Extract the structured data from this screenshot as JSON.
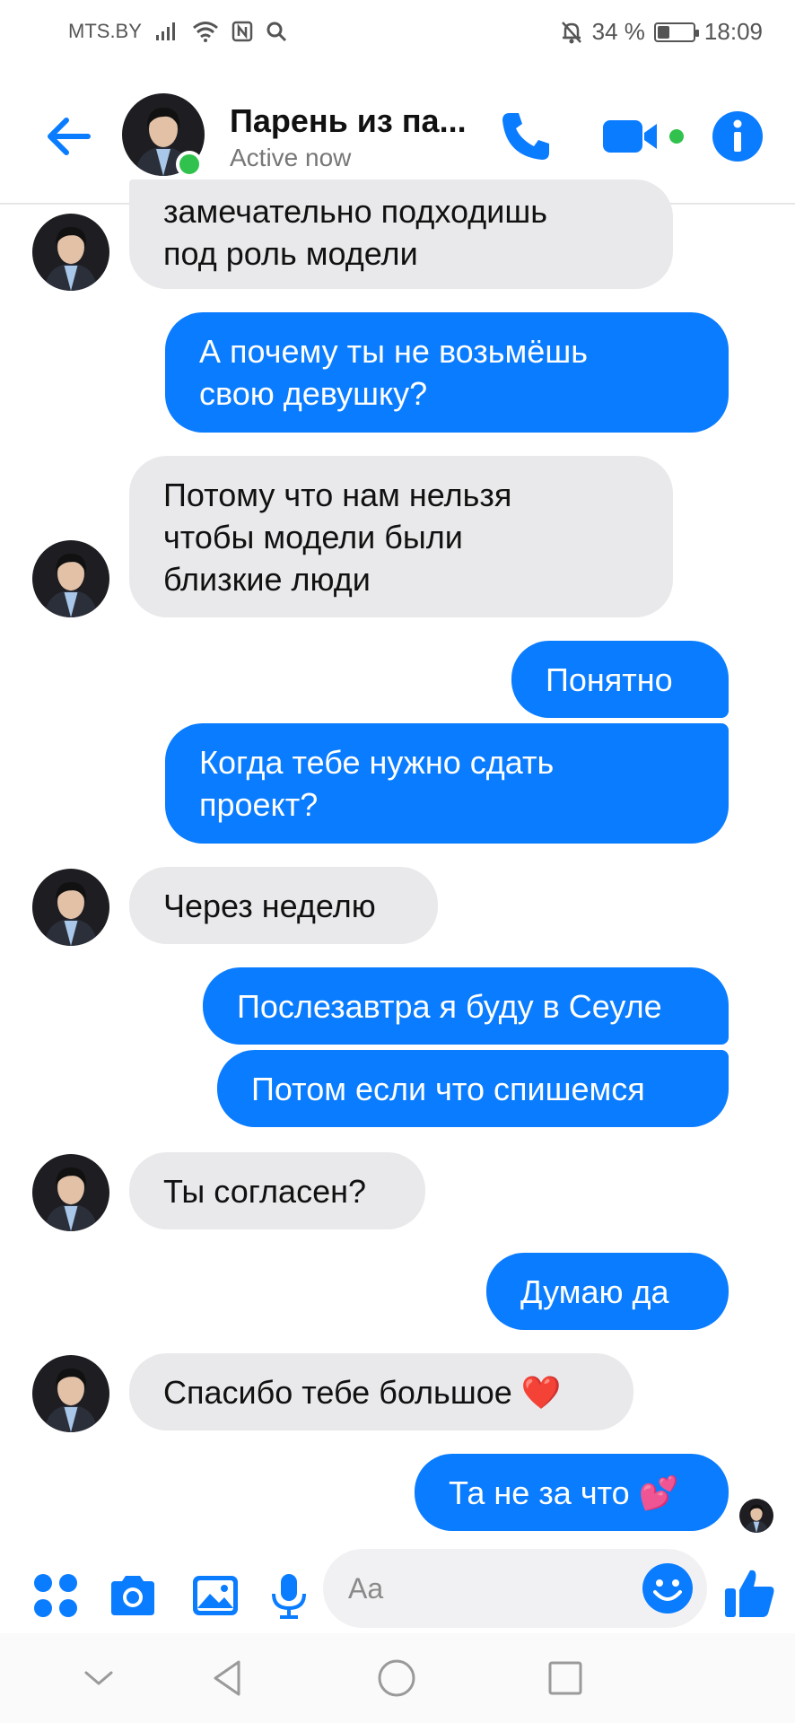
{
  "status_bar": {
    "carrier": "MTS.BY",
    "battery_label": "34 %",
    "battery_level": 0.34,
    "time": "18:09"
  },
  "header": {
    "contact_name": "Парень из па...",
    "contact_status": "Active now",
    "online": true
  },
  "messages": [
    {
      "side": "in",
      "text": "замечательно подходишь\nпод роль модели"
    },
    {
      "side": "out",
      "text": "А почему ты не возьмёшь\nсвою девушку?"
    },
    {
      "side": "in",
      "text": "Потому что нам нельзя\nчтобы модели были\nблизкие люди"
    },
    {
      "side": "out",
      "text": "Понятно"
    },
    {
      "side": "out",
      "text": "Когда тебе нужно сдать\nпроект?"
    },
    {
      "side": "in",
      "text": "Через неделю"
    },
    {
      "side": "out",
      "text": "Послезавтра я буду в Сеуле"
    },
    {
      "side": "out",
      "text": "Потом если что спишемся"
    },
    {
      "side": "in",
      "text": "Ты согласен?"
    },
    {
      "side": "out",
      "text": "Думаю да"
    },
    {
      "side": "in",
      "text": "Спасибо тебе большое ❤️"
    },
    {
      "side": "out",
      "text": "Та не за что 💕"
    }
  ],
  "composer": {
    "placeholder": "Aa"
  },
  "colors": {
    "accent": "#0a7cff",
    "incoming_bubble": "#e9e9eb",
    "online": "#31c24d"
  }
}
